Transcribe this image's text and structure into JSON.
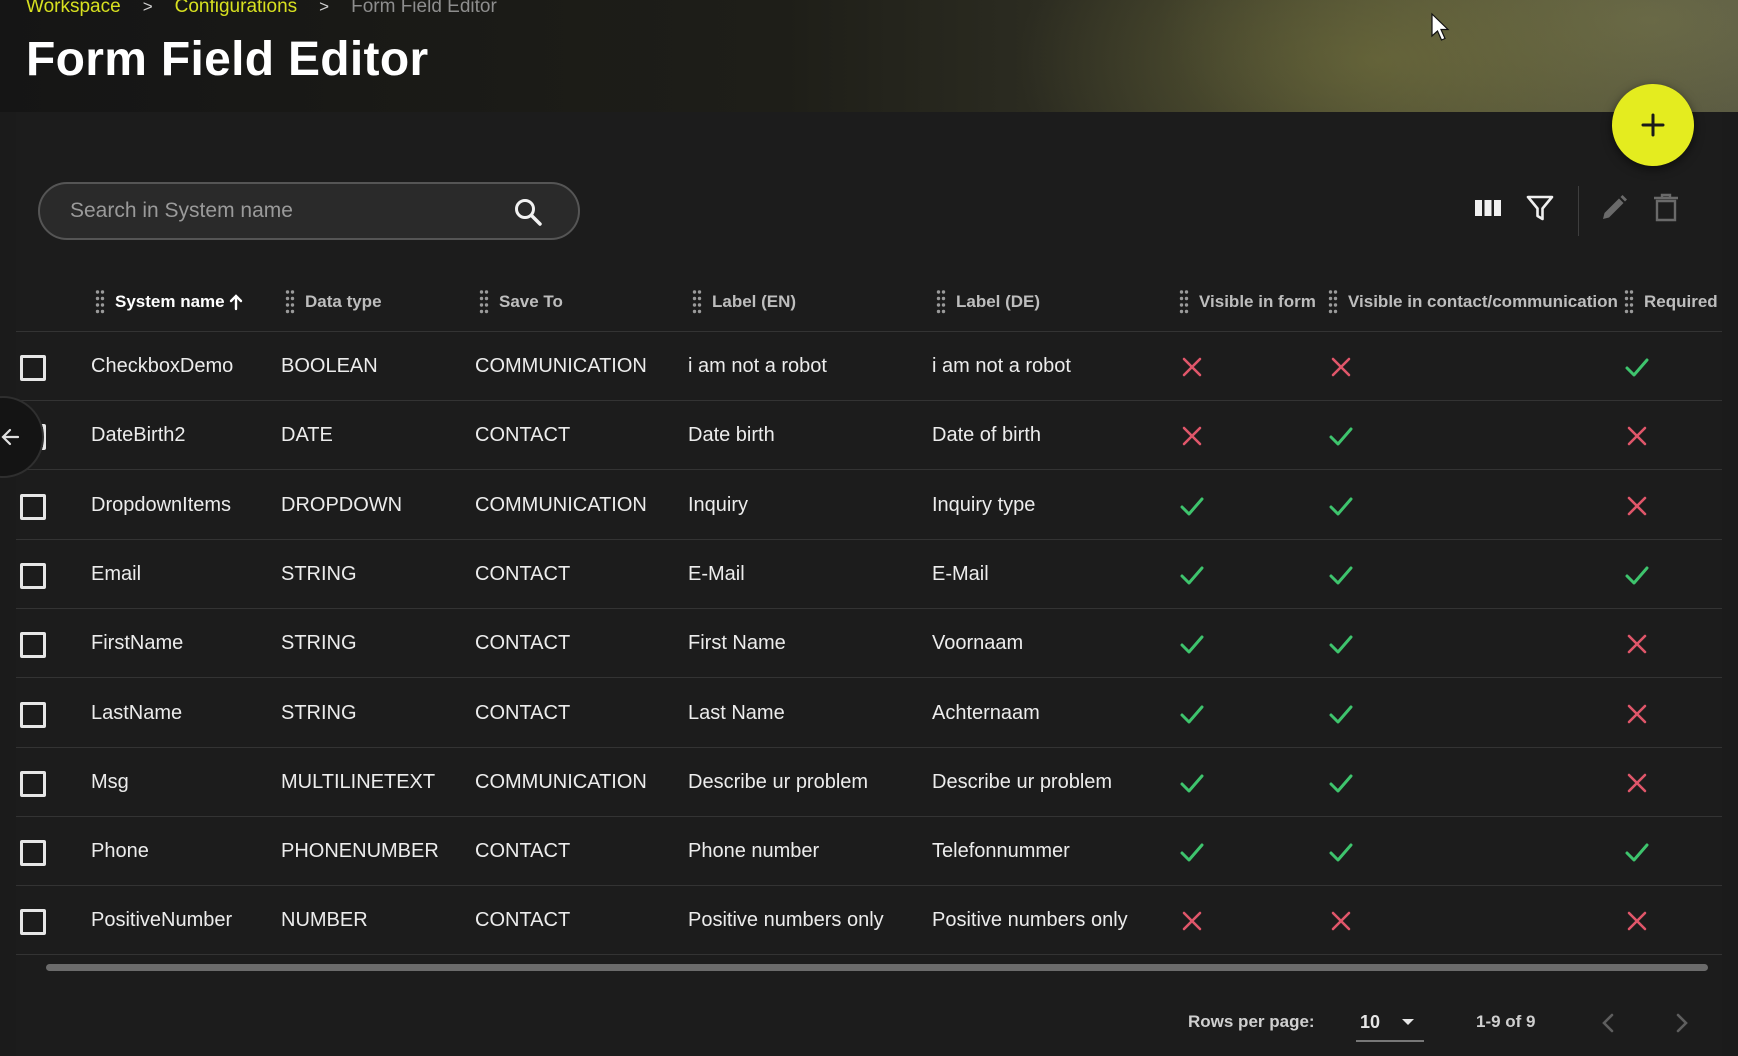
{
  "breadcrumb": {
    "items": [
      "Workspace",
      "Configurations"
    ],
    "current": "Form Field Editor",
    "separator": ">"
  },
  "page": {
    "title": "Form Field Editor"
  },
  "colors": {
    "accent": "#e4ec1f",
    "breadcrumb_link": "#d7e020",
    "check": "#3ec46d",
    "cross": "#e0566a"
  },
  "search": {
    "placeholder": "Search in System name",
    "value": ""
  },
  "toolbar": {
    "icons": [
      "columns-icon",
      "filter-icon",
      "edit-icon",
      "delete-icon"
    ]
  },
  "table": {
    "columns": [
      "System name",
      "Data type",
      "Save To",
      "Label (EN)",
      "Label (DE)",
      "Visible in form",
      "Visible in contact/communication",
      "Required"
    ],
    "sort": {
      "column": "System name",
      "direction": "asc"
    },
    "rows": [
      {
        "system_name": "CheckboxDemo",
        "data_type": "BOOLEAN",
        "save_to": "COMMUNICATION",
        "label_en": "i am not a robot",
        "label_de": "i am not a robot",
        "visible_in_form": false,
        "visible_in_contact": false,
        "required": true
      },
      {
        "system_name": "DateBirth2",
        "data_type": "DATE",
        "save_to": "CONTACT",
        "label_en": "Date birth",
        "label_de": "Date of birth",
        "visible_in_form": false,
        "visible_in_contact": true,
        "required": false
      },
      {
        "system_name": "DropdownItems",
        "data_type": "DROPDOWN",
        "save_to": "COMMUNICATION",
        "label_en": "Inquiry",
        "label_de": "Inquiry type",
        "visible_in_form": true,
        "visible_in_contact": true,
        "required": false
      },
      {
        "system_name": "Email",
        "data_type": "STRING",
        "save_to": "CONTACT",
        "label_en": "E-Mail",
        "label_de": "E-Mail",
        "visible_in_form": true,
        "visible_in_contact": true,
        "required": true
      },
      {
        "system_name": "FirstName",
        "data_type": "STRING",
        "save_to": "CONTACT",
        "label_en": "First Name",
        "label_de": "Voornaam",
        "visible_in_form": true,
        "visible_in_contact": true,
        "required": false
      },
      {
        "system_name": "LastName",
        "data_type": "STRING",
        "save_to": "CONTACT",
        "label_en": "Last Name",
        "label_de": "Achternaam",
        "visible_in_form": true,
        "visible_in_contact": true,
        "required": false
      },
      {
        "system_name": "Msg",
        "data_type": "MULTILINETEXT",
        "save_to": "COMMUNICATION",
        "label_en": "Describe ur problem",
        "label_de": "Describe ur problem",
        "visible_in_form": true,
        "visible_in_contact": true,
        "required": false
      },
      {
        "system_name": "Phone",
        "data_type": "PHONENUMBER",
        "save_to": "CONTACT",
        "label_en": "Phone number",
        "label_de": "Telefonnummer",
        "visible_in_form": true,
        "visible_in_contact": true,
        "required": true
      },
      {
        "system_name": "PositiveNumber",
        "data_type": "NUMBER",
        "save_to": "CONTACT",
        "label_en": "Positive numbers only",
        "label_de": "Positive numbers only",
        "visible_in_form": false,
        "visible_in_contact": false,
        "required": false
      }
    ]
  },
  "pagination": {
    "rows_per_page_label": "Rows per page:",
    "rows_per_page": "10",
    "range": "1-9 of 9"
  }
}
